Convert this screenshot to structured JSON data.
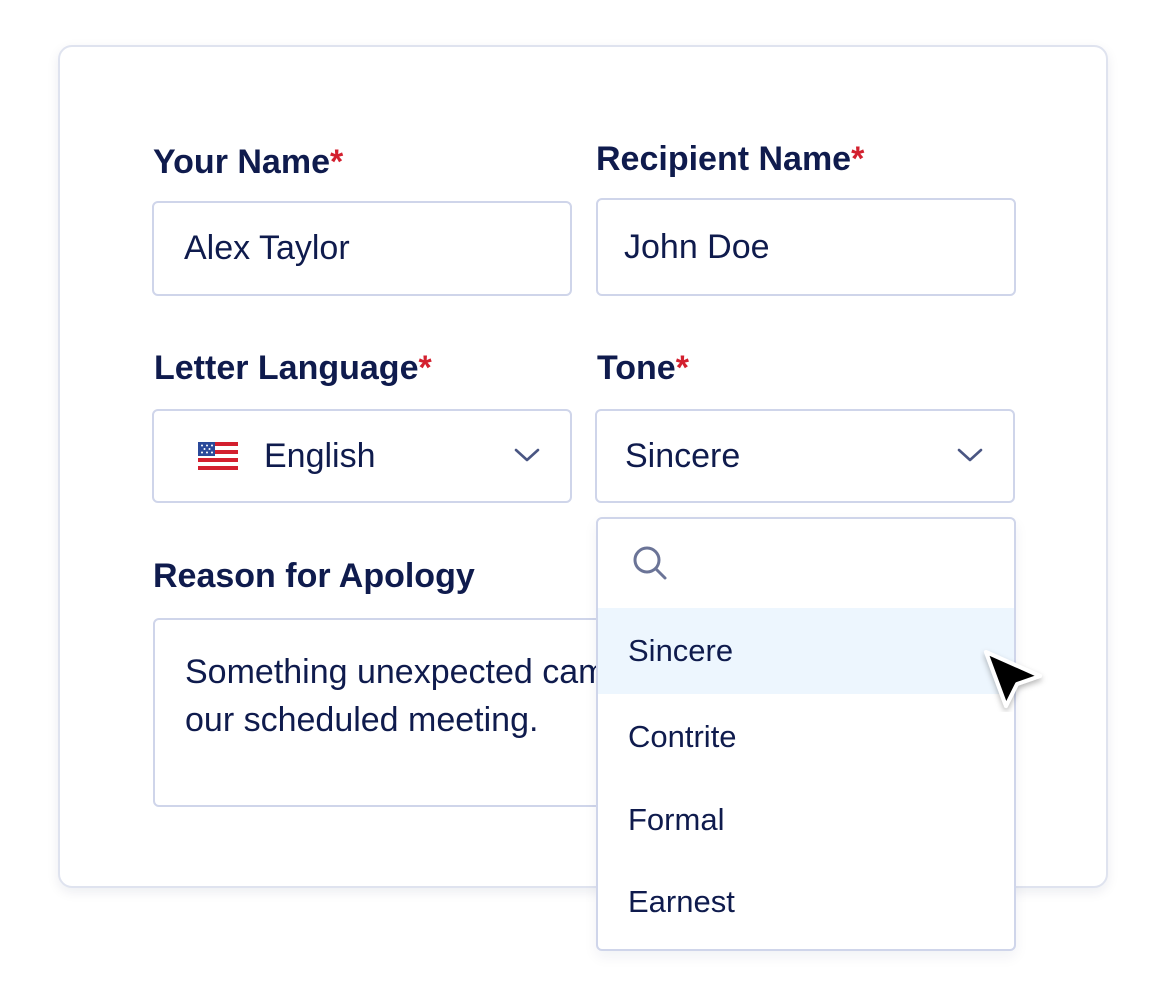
{
  "form": {
    "your_name": {
      "label": "Your Name",
      "required_mark": "*",
      "value": "Alex Taylor"
    },
    "recipient_name": {
      "label": "Recipient Name",
      "required_mark": "*",
      "value": "John Doe"
    },
    "letter_language": {
      "label": "Letter Language",
      "required_mark": "*",
      "value": "English",
      "flag_icon": "us-flag-icon"
    },
    "tone": {
      "label": "Tone",
      "required_mark": "*",
      "value": "Sincere"
    },
    "reason": {
      "label": "Reason for Apology",
      "value": "Something unexpected came up and I couldn't make it to our scheduled meeting."
    }
  },
  "tone_dropdown": {
    "search_placeholder": "",
    "options": [
      "Sincere",
      "Contrite",
      "Formal",
      "Earnest"
    ],
    "highlighted": "Sincere"
  },
  "colors": {
    "text": "#0f1b4d",
    "required": "#d3202f",
    "border": "#cfd5ea",
    "highlight": "#edf6fe"
  }
}
